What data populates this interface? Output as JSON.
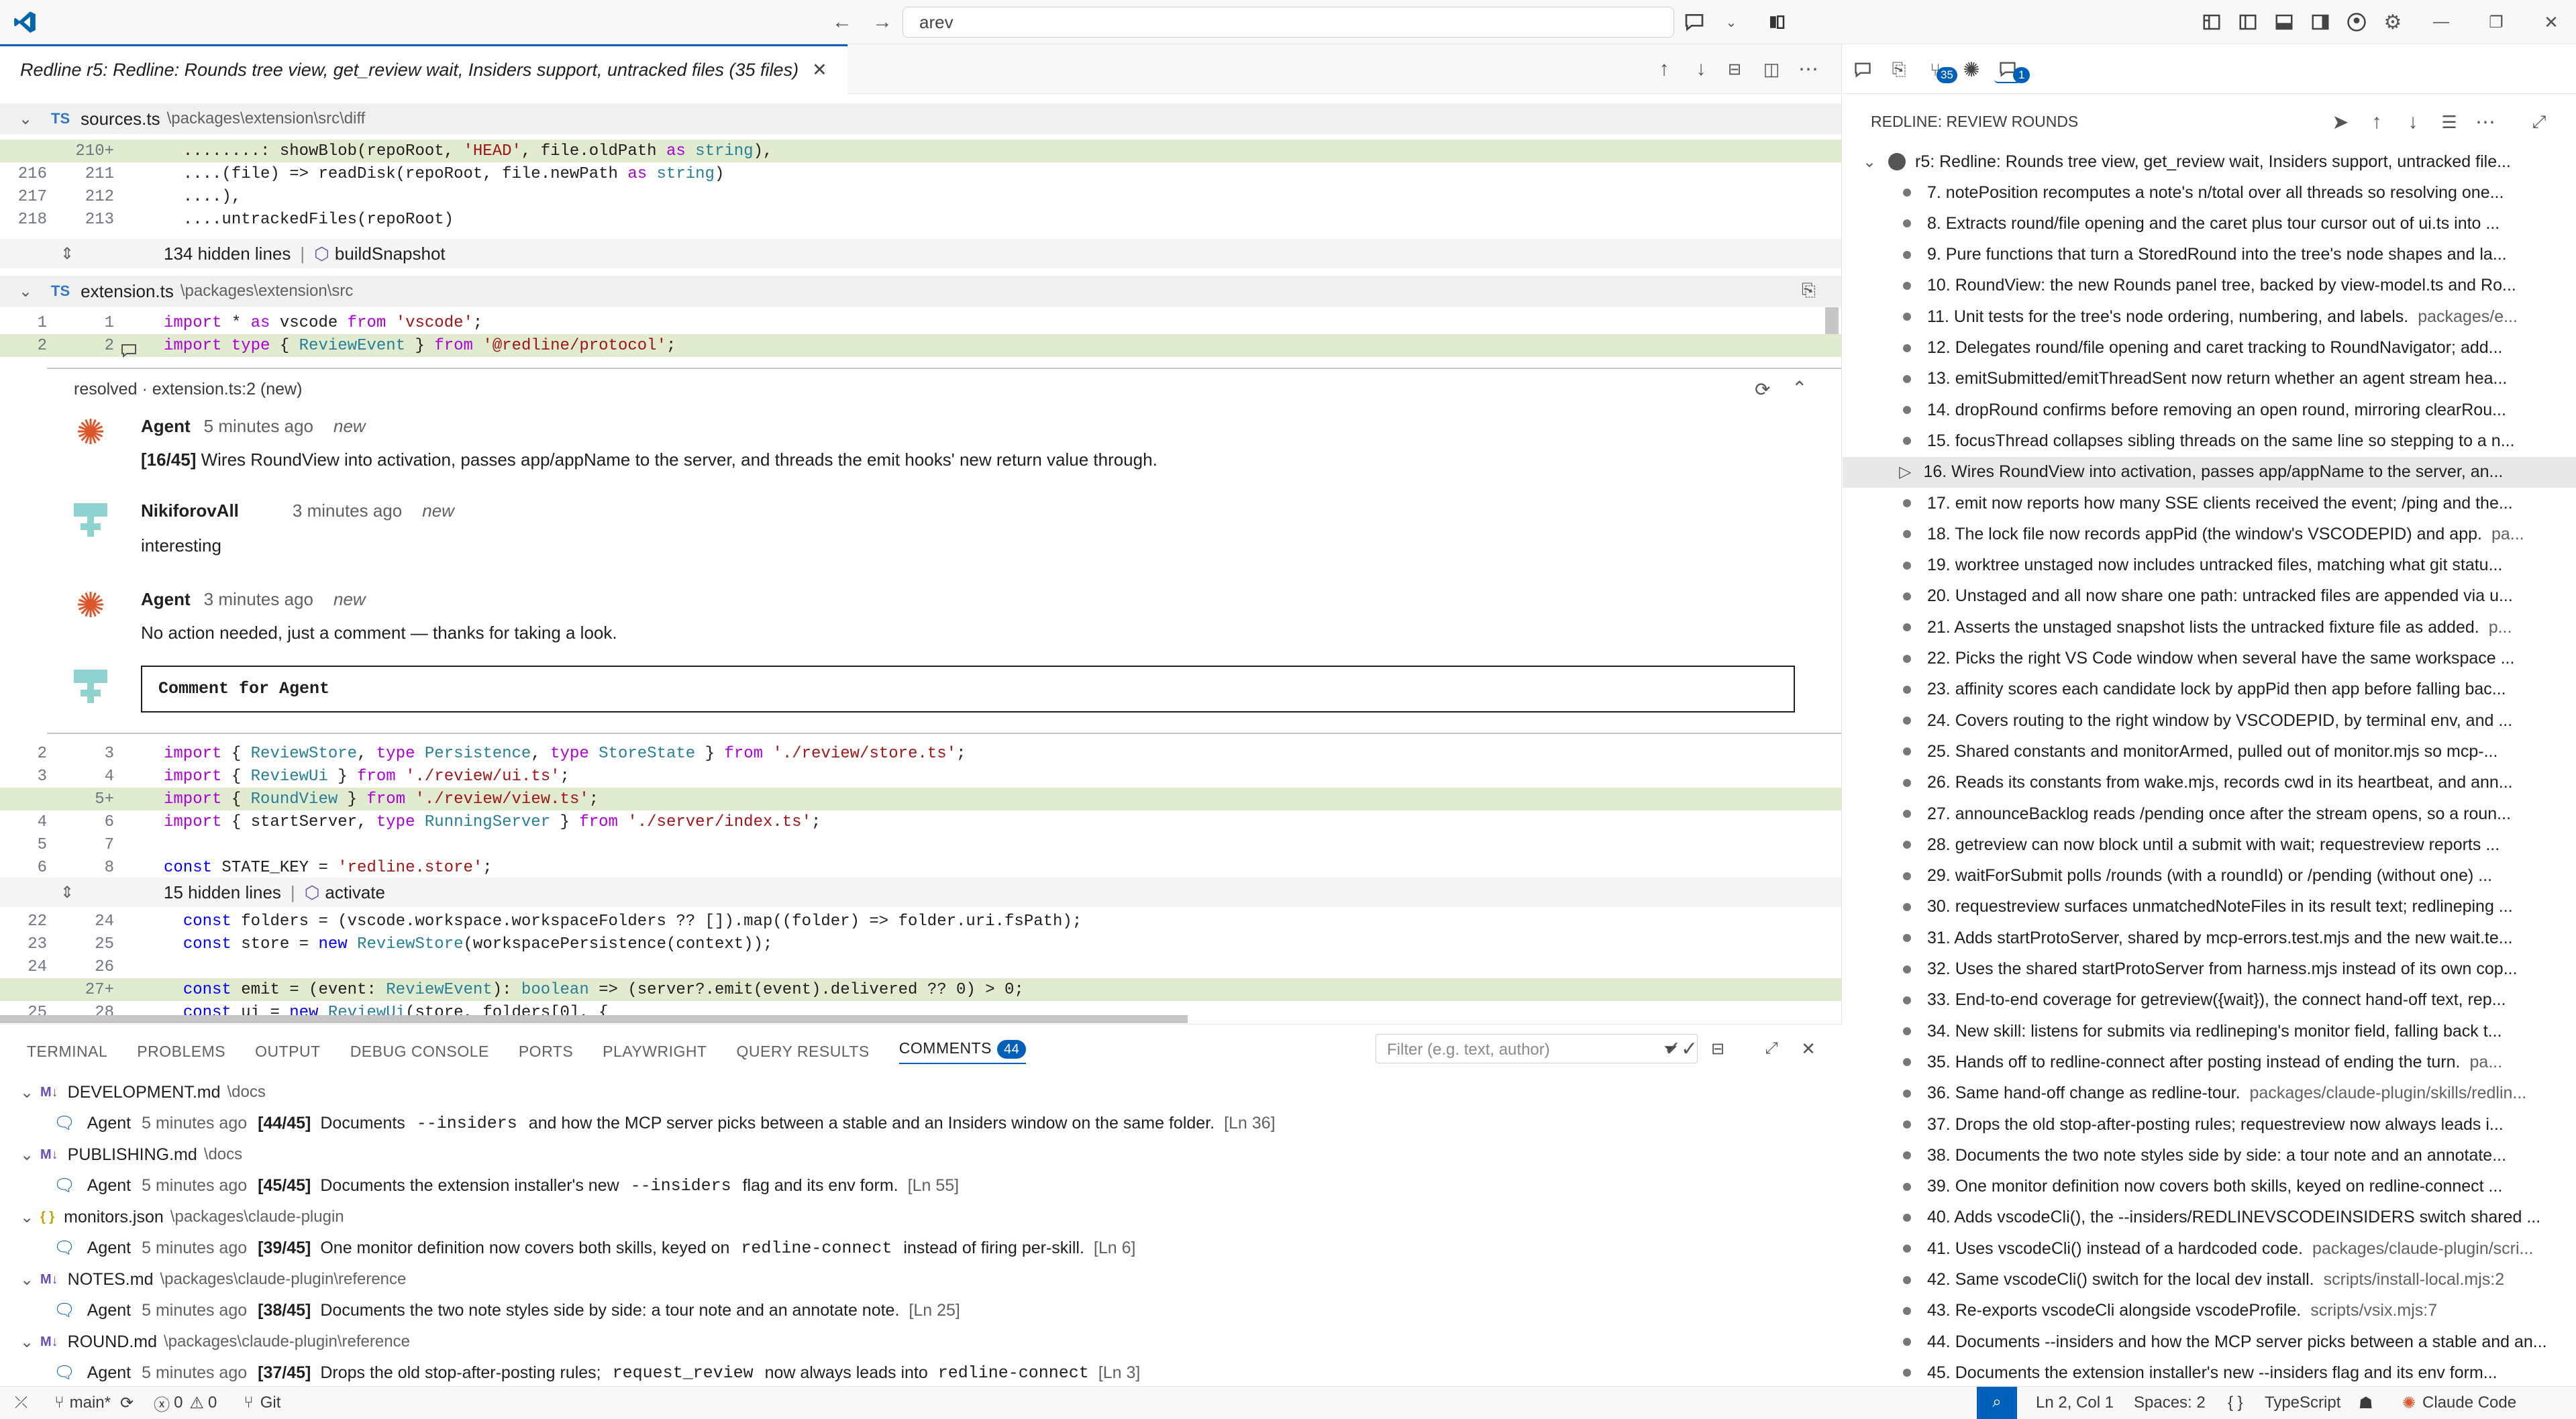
{
  "titlebar": {
    "search": "arev"
  },
  "editor": {
    "tab_title": "Redline r5: Redline: Rounds tree view, get_review wait, Insiders support, untracked files (35 files)",
    "file1": {
      "name": "sources.ts",
      "path": "\\packages\\extension\\src\\diff"
    },
    "file1_lines": [
      {
        "a": "",
        "b": "210+",
        "added": true,
        "text": "  ........: showBlob(repoRoot, 'HEAD', file.oldPath as string),"
      },
      {
        "a": "216",
        "b": "211",
        "added": false,
        "text": "  ....(file) => readDisk(repoRoot, file.newPath as string)"
      },
      {
        "a": "217",
        "b": "212",
        "added": false,
        "text": "  ....),"
      },
      {
        "a": "218",
        "b": "213",
        "added": false,
        "text": "  ....untrackedFiles(repoRoot)"
      }
    ],
    "file1_hidden": {
      "count": "134 hidden lines",
      "symbol": "buildSnapshot"
    },
    "file2": {
      "name": "extension.ts",
      "path": "\\packages\\extension\\src"
    },
    "file2_top": [
      {
        "a": "1",
        "b": "1",
        "added": false,
        "text": "import * as vscode from 'vscode';"
      },
      {
        "a": "2",
        "b": "2",
        "added": true,
        "text": "import type { ReviewEvent } from '@redline/protocol';"
      }
    ],
    "thread": {
      "header": "resolved · extension.ts:2 (new)",
      "comments": [
        {
          "author": "Agent",
          "time": "5 minutes ago",
          "tag": "new",
          "prefix": "[16/45]",
          "body": " Wires RoundView into activation, passes app/appName to the server, and threads the emit hooks' new return value through."
        },
        {
          "author": "NikiforovAll",
          "time": "3 minutes ago",
          "tag": "new",
          "prefix": "",
          "body": "interesting"
        },
        {
          "author": "Agent",
          "time": "3 minutes ago",
          "tag": "new",
          "prefix": "",
          "body": "No action needed, just a comment — thanks for taking a look."
        }
      ],
      "reply_placeholder": "Comment for Agent"
    },
    "file2_mid": [
      {
        "a": "2",
        "b": "3",
        "added": false,
        "text": "import { ReviewStore, type Persistence, type StoreState } from './review/store.ts';"
      },
      {
        "a": "3",
        "b": "4",
        "added": false,
        "text": "import { ReviewUi } from './review/ui.ts';"
      },
      {
        "a": "",
        "b": "5+",
        "added": true,
        "text": "import { RoundView } from './review/view.ts';"
      },
      {
        "a": "4",
        "b": "6",
        "added": false,
        "text": "import { startServer, type RunningServer } from './server/index.ts';"
      },
      {
        "a": "5",
        "b": "7",
        "added": false,
        "text": ""
      },
      {
        "a": "6",
        "b": "8",
        "added": false,
        "text": "const STATE_KEY = 'redline.store';"
      }
    ],
    "file2_hidden": {
      "count": "15 hidden lines",
      "symbol": "activate"
    },
    "file2_bottom": [
      {
        "a": "22",
        "b": "24",
        "added": false,
        "text": "  const folders = (vscode.workspace.workspaceFolders ?? []).map((folder) => folder.uri.fsPath);"
      },
      {
        "a": "23",
        "b": "25",
        "added": false,
        "text": "  const store = new ReviewStore(workspacePersistence(context));"
      },
      {
        "a": "24",
        "b": "26",
        "added": false,
        "text": ""
      },
      {
        "a": "",
        "b": "27+",
        "added": true,
        "text": "  const emit = (event: ReviewEvent): boolean => (server?.emit(event).delivered ?? 0) > 0;"
      },
      {
        "a": "25",
        "b": "28",
        "added": false,
        "text": "  const ui = new ReviewUi(store, folders[0], {"
      }
    ]
  },
  "panel": {
    "tabs": [
      "TERMINAL",
      "PROBLEMS",
      "OUTPUT",
      "DEBUG CONSOLE",
      "PORTS",
      "PLAYWRIGHT",
      "QUERY RESULTS",
      "COMMENTS"
    ],
    "comments_count": "44",
    "filter_placeholder": "Filter (e.g. text, author)",
    "groups": [
      {
        "icon": "M↓",
        "file": "DEVELOPMENT.md",
        "path": "\\docs",
        "author": "Agent",
        "time": "5 minutes ago",
        "num": "[44/45]",
        "pre": "Documents ",
        "code": "--insiders",
        "post": " and how the MCP server picks between a stable and an Insiders window on the same folder.",
        "ln": "[Ln 36]"
      },
      {
        "icon": "M↓",
        "file": "PUBLISHING.md",
        "path": "\\docs",
        "author": "Agent",
        "time": "5 minutes ago",
        "num": "[45/45]",
        "pre": "Documents the extension installer's new ",
        "code": "--insiders",
        "post": " flag and its env form.",
        "ln": "[Ln 55]"
      },
      {
        "icon": "{ }",
        "file": "monitors.json",
        "path": "\\packages\\claude-plugin",
        "author": "Agent",
        "time": "5 minutes ago",
        "num": "[39/45]",
        "pre": "One monitor definition now covers both skills, keyed on ",
        "code": "redline-connect",
        "post": " instead of firing per-skill.",
        "ln": "[Ln 6]"
      },
      {
        "icon": "M↓",
        "file": "NOTES.md",
        "path": "\\packages\\claude-plugin\\reference",
        "author": "Agent",
        "time": "5 minutes ago",
        "num": "[38/45]",
        "pre": "Documents the two note styles side by side: a tour note and an annotate note.",
        "code": "",
        "post": "",
        "ln": "[Ln 25]"
      },
      {
        "icon": "M↓",
        "file": "ROUND.md",
        "path": "\\packages\\claude-plugin\\reference",
        "author": "Agent",
        "time": "5 minutes ago",
        "num": "[37/45]",
        "pre": "Drops the old stop-after-posting rules; ",
        "code": "request_review",
        "post": " now always leads into ",
        "code2": "redline-connect",
        "ln": "[Ln 3]"
      }
    ]
  },
  "sidebar": {
    "badge_a": "35",
    "badge_b": "1",
    "title": "REDLINE: REVIEW ROUNDS",
    "round": "r5: Redline: Rounds tree view, get_review wait, Insiders support, untracked file...",
    "items": [
      {
        "t": "7. notePosition recomputes a note's n/total over all threads so resolving one...",
        "p": ""
      },
      {
        "t": "8. Extracts round/file opening and the caret plus tour cursor out of ui.ts into ...",
        "p": ""
      },
      {
        "t": "9. Pure functions that turn a StoredRound into the tree's node shapes and la...",
        "p": ""
      },
      {
        "t": "10. RoundView: the new Rounds panel tree, backed by view-model.ts and Ro...",
        "p": ""
      },
      {
        "t": "11. Unit tests for the tree's node ordering, numbering, and labels.",
        "p": "packages/e..."
      },
      {
        "t": "12. Delegates round/file opening and caret tracking to RoundNavigator; add...",
        "p": ""
      },
      {
        "t": "13. emitSubmitted/emitThreadSent now return whether an agent stream hea...",
        "p": ""
      },
      {
        "t": "14. dropRound confirms before removing an open round, mirroring clearRou...",
        "p": ""
      },
      {
        "t": "15. focusThread collapses sibling threads on the same line so stepping to a n...",
        "p": ""
      },
      {
        "t": "16. Wires RoundView into activation, passes app/appName to the server, an...",
        "p": ""
      },
      {
        "t": "17. emit now reports how many SSE clients received the event; /ping and the...",
        "p": ""
      },
      {
        "t": "18. The lock file now records appPid (the window's VSCODEPID) and app.",
        "p": "pa..."
      },
      {
        "t": "19. worktree unstaged now includes untracked files, matching what git statu...",
        "p": ""
      },
      {
        "t": "20. Unstaged and all now share one path: untracked files are appended via u...",
        "p": ""
      },
      {
        "t": "21. Asserts the unstaged snapshot lists the untracked fixture file as added.",
        "p": "p..."
      },
      {
        "t": "22. Picks the right VS Code window when several have the same workspace ...",
        "p": ""
      },
      {
        "t": "23. affinity scores each candidate lock by appPid then app before falling bac...",
        "p": ""
      },
      {
        "t": "24. Covers routing to the right window by VSCODEPID, by terminal env, and ...",
        "p": ""
      },
      {
        "t": "25. Shared constants and monitorArmed, pulled out of monitor.mjs so mcp-...",
        "p": ""
      },
      {
        "t": "26. Reads its constants from wake.mjs, records cwd in its heartbeat, and ann...",
        "p": ""
      },
      {
        "t": "27. announceBacklog reads /pending once after the stream opens, so a roun...",
        "p": ""
      },
      {
        "t": "28. getreview can now block until a submit with wait; requestreview reports ...",
        "p": ""
      },
      {
        "t": "29. waitForSubmit polls /rounds (with a roundId) or /pending (without one) ...",
        "p": ""
      },
      {
        "t": "30. requestreview surfaces unmatchedNoteFiles in its result text; redlineping ...",
        "p": ""
      },
      {
        "t": "31. Adds startProtoServer, shared by mcp-errors.test.mjs and the new wait.te...",
        "p": ""
      },
      {
        "t": "32. Uses the shared startProtoServer from harness.mjs instead of its own cop...",
        "p": ""
      },
      {
        "t": "33. End-to-end coverage for getreview({wait}), the connect hand-off text, rep...",
        "p": ""
      },
      {
        "t": "34. New skill: listens for submits via redlineping's monitor field, falling back t...",
        "p": ""
      },
      {
        "t": "35. Hands off to redline-connect after posting instead of ending the turn.",
        "p": "pa..."
      },
      {
        "t": "36. Same hand-off change as redline-tour.",
        "p": "packages/claude-plugin/skills/redlin..."
      },
      {
        "t": "37. Drops the old stop-after-posting rules; requestreview now always leads i...",
        "p": ""
      },
      {
        "t": "38. Documents the two note styles side by side: a tour note and an annotate...",
        "p": ""
      },
      {
        "t": "39. One monitor definition now covers both skills, keyed on redline-connect ...",
        "p": ""
      },
      {
        "t": "40. Adds vscodeCli(), the --insiders/REDLINEVSCODEINSIDERS switch shared ...",
        "p": ""
      },
      {
        "t": "41. Uses vscodeCli() instead of a hardcoded code.",
        "p": "packages/claude-plugin/scri..."
      },
      {
        "t": "42. Same vscodeCli() switch for the local dev install.",
        "p": "scripts/install-local.mjs:2"
      },
      {
        "t": "43. Re-exports vscodeCli alongside vscodeProfile.",
        "p": "scripts/vsix.mjs:7"
      },
      {
        "t": "44. Documents --insiders and how the MCP server picks between a stable and an...",
        "p": ""
      },
      {
        "t": "45. Documents the extension installer's new --insiders flag and its env form...",
        "p": ""
      }
    ]
  },
  "status": {
    "branch": "main*",
    "errors": "0",
    "warnings": "0",
    "git": "Git",
    "position": "Ln 2, Col 1",
    "spaces": "Spaces: 2",
    "lang": "TypeScript",
    "claude": "Claude Code"
  },
  "colors": {
    "accent": "#005fb8",
    "added_bg": "#e1ebd0",
    "agent": "#d9572b"
  }
}
